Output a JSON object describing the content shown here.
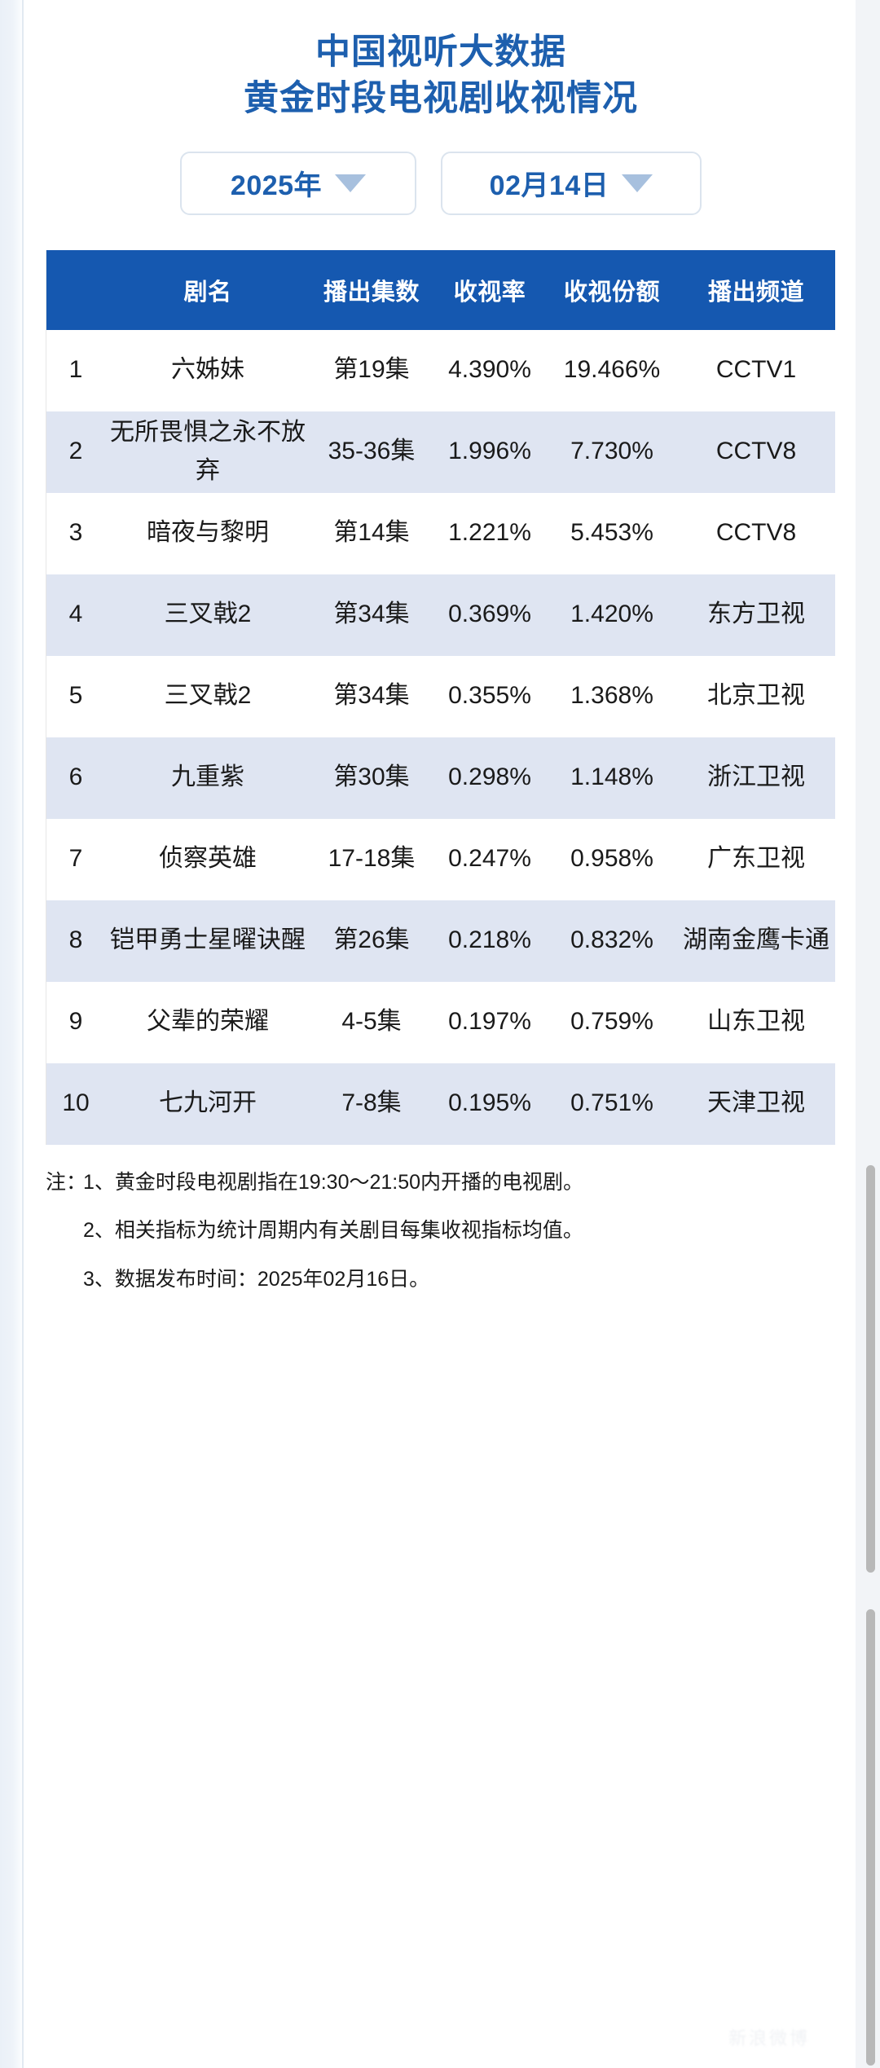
{
  "header": {
    "title_line1": "中国视听大数据",
    "title_line2": "黄金时段电视剧收视情况",
    "title_color": "#1d5fae"
  },
  "selectors": {
    "year": {
      "label": "2025年",
      "icon": "chevron-down-icon"
    },
    "date": {
      "label": "02月14日",
      "icon": "chevron-down-icon"
    }
  },
  "table": {
    "header_bg": "#1558b0",
    "row_alt_bg": "#dfe5f2",
    "columns": [
      "",
      "剧名",
      "播出集数",
      "收视率",
      "收视份额",
      "播出频道"
    ],
    "rows": [
      {
        "rank": "1",
        "name": "六姊妹",
        "episodes": "第19集",
        "rating": "4.390%",
        "share": "19.466%",
        "channel": "CCTV1"
      },
      {
        "rank": "2",
        "name": "无所畏惧之永不放弃",
        "episodes": "35-36集",
        "rating": "1.996%",
        "share": "7.730%",
        "channel": "CCTV8"
      },
      {
        "rank": "3",
        "name": "暗夜与黎明",
        "episodes": "第14集",
        "rating": "1.221%",
        "share": "5.453%",
        "channel": "CCTV8"
      },
      {
        "rank": "4",
        "name": "三叉戟2",
        "episodes": "第34集",
        "rating": "0.369%",
        "share": "1.420%",
        "channel": "东方卫视"
      },
      {
        "rank": "5",
        "name": "三叉戟2",
        "episodes": "第34集",
        "rating": "0.355%",
        "share": "1.368%",
        "channel": "北京卫视"
      },
      {
        "rank": "6",
        "name": "九重紫",
        "episodes": "第30集",
        "rating": "0.298%",
        "share": "1.148%",
        "channel": "浙江卫视"
      },
      {
        "rank": "7",
        "name": "侦察英雄",
        "episodes": "17-18集",
        "rating": "0.247%",
        "share": "0.958%",
        "channel": "广东卫视"
      },
      {
        "rank": "8",
        "name": "铠甲勇士星曜诀醒",
        "episodes": "第26集",
        "rating": "0.218%",
        "share": "0.832%",
        "channel": "湖南金鹰卡通"
      },
      {
        "rank": "9",
        "name": "父辈的荣耀",
        "episodes": "4-5集",
        "rating": "0.197%",
        "share": "0.759%",
        "channel": "山东卫视"
      },
      {
        "rank": "10",
        "name": "七九河开",
        "episodes": "7-8集",
        "rating": "0.195%",
        "share": "0.751%",
        "channel": "天津卫视"
      }
    ]
  },
  "notes": {
    "label": "注：",
    "items": [
      {
        "num": "1、",
        "text": "黄金时段电视剧指在19:30～21:50内开播的电视剧。"
      },
      {
        "num": "2、",
        "text": "相关指标为统计周期内有关剧目每集收视指标均值。"
      },
      {
        "num": "3、",
        "text": "数据发布时间：2025年02月16日。"
      }
    ]
  },
  "watermark": {
    "text": "新浪微博"
  }
}
